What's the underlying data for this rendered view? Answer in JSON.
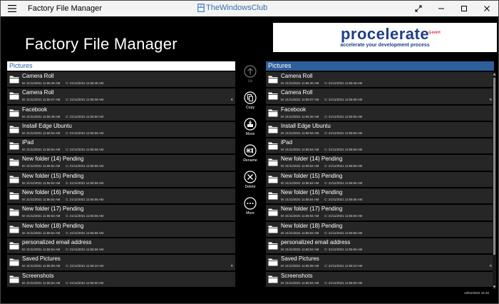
{
  "window": {
    "title": "Factory File Manager",
    "watermark": "TheWindowsClub"
  },
  "header": {
    "big_title": "Factory File Manager",
    "banner": {
      "brand": "procelerate",
      "gmbh": "GmbH",
      "tagline": "accelerate your development process"
    }
  },
  "colors": {
    "accent": "#2d5f9a",
    "row_bg": "#262626",
    "background": "#000000"
  },
  "left_pane": {
    "header": "Pictures",
    "items": [
      {
        "name": "Camera Roll",
        "modified": "M: 21/11/2021 11:55:46 AM",
        "created": "C: 21/11/2021 11:55:48 AM",
        "flag": ""
      },
      {
        "name": "Camera Roll",
        "modified": "M: 21/11/2021 11:55:07 AM",
        "created": "C: 21/11/2021 11:55:08 AM",
        "flag": "R"
      },
      {
        "name": "Facebook",
        "modified": "M: 21/11/2021 11:55:48 AM",
        "created": "C: 21/11/2021 11:55:50 AM",
        "flag": ""
      },
      {
        "name": "Install Edge Ubuntu",
        "modified": "M: 21/11/2021 11:55:54 AM",
        "created": "C: 21/11/2021 11:55:56 AM",
        "flag": ""
      },
      {
        "name": "iPad",
        "modified": "M: 21/11/2021 11:55:54 AM",
        "created": "C: 21/11/2021 11:55:56 AM",
        "flag": ""
      },
      {
        "name": "New folder (14) Pending",
        "modified": "M: 21/11/2021 11:55:54 AM",
        "created": "C: 21/11/2021 11:55:56 AM",
        "flag": ""
      },
      {
        "name": "New folder (15) Pending",
        "modified": "M: 21/11/2021 11:55:54 AM",
        "created": "C: 21/11/2021 11:55:56 AM",
        "flag": ""
      },
      {
        "name": "New folder (16) Pending",
        "modified": "M: 21/11/2021 11:55:54 AM",
        "created": "C: 21/11/2021 11:55:56 AM",
        "flag": ""
      },
      {
        "name": "New folder (17) Pending",
        "modified": "M: 21/11/2021 11:55:54 AM",
        "created": "C: 21/11/2021 11:55:56 AM",
        "flag": ""
      },
      {
        "name": "New folder (18) Pending",
        "modified": "M: 21/11/2021 11:55:54 AM",
        "created": "C: 21/11/2021 11:55:56 AM",
        "flag": ""
      },
      {
        "name": "personalized email address",
        "modified": "M: 21/11/2021 11:55:54 AM",
        "created": "C: 21/11/2021 11:55:56 AM",
        "flag": ""
      },
      {
        "name": "Saved Pictures",
        "modified": "M: 21/11/2021 11:55:08 AM",
        "created": "C: 21/11/2021 11:55:10 AM",
        "flag": "R"
      },
      {
        "name": "Screenshots",
        "modified": "M: 21/11/2021 11:55:54 AM",
        "created": "C: 21/11/2021 11:55:50 AM",
        "flag": ""
      }
    ]
  },
  "right_pane": {
    "header": "Pictures",
    "items": [
      {
        "name": "Camera Roll",
        "modified": "M: 21/11/2021 11:55:46 AM",
        "created": "C: 21/11/2021 11:55:48 AM",
        "flag": ""
      },
      {
        "name": "Camera Roll",
        "modified": "M: 21/11/2021 11:55:07 AM",
        "created": "C: 21/11/2021 11:55:08 AM",
        "flag": "R"
      },
      {
        "name": "Facebook",
        "modified": "M: 21/11/2021 11:55:48 AM",
        "created": "C: 21/11/2021 11:55:50 AM",
        "flag": ""
      },
      {
        "name": "Install Edge Ubuntu",
        "modified": "M: 21/11/2021 11:55:54 AM",
        "created": "C: 21/11/2021 11:55:56 AM",
        "flag": ""
      },
      {
        "name": "iPad",
        "modified": "M: 21/11/2021 11:55:54 AM",
        "created": "C: 21/11/2021 11:55:56 AM",
        "flag": ""
      },
      {
        "name": "New folder (14) Pending",
        "modified": "M: 21/11/2021 11:55:54 AM",
        "created": "C: 21/11/2021 11:55:56 AM",
        "flag": ""
      },
      {
        "name": "New folder (15) Pending",
        "modified": "M: 21/11/2021 11:55:54 AM",
        "created": "C: 21/11/2021 11:55:56 AM",
        "flag": ""
      },
      {
        "name": "New folder (16) Pending",
        "modified": "M: 21/11/2021 11:55:54 AM",
        "created": "C: 21/11/2021 11:55:56 AM",
        "flag": ""
      },
      {
        "name": "New folder (17) Pending",
        "modified": "M: 21/11/2021 11:55:54 AM",
        "created": "C: 21/11/2021 11:55:56 AM",
        "flag": ""
      },
      {
        "name": "New folder (18) Pending",
        "modified": "M: 21/11/2021 11:55:54 AM",
        "created": "C: 21/11/2021 11:55:56 AM",
        "flag": ""
      },
      {
        "name": "personalized email address",
        "modified": "M: 21/11/2021 11:55:54 AM",
        "created": "C: 21/11/2021 11:55:56 AM",
        "flag": ""
      },
      {
        "name": "Saved Pictures",
        "modified": "M: 21/11/2021 11:55:08 AM",
        "created": "C: 21/11/2021 11:55:10 AM",
        "flag": "R"
      },
      {
        "name": "Screenshots",
        "modified": "M: 21/11/2021 11:55:54 AM",
        "created": "C: 21/11/2021 11:55:50 AM",
        "flag": ""
      }
    ]
  },
  "actions": [
    {
      "label": "Up",
      "icon": "arrow-up-icon",
      "enabled": false
    },
    {
      "label": "Copy",
      "icon": "copy-icon",
      "enabled": true
    },
    {
      "label": "Move",
      "icon": "move-icon",
      "enabled": true
    },
    {
      "label": "Rename",
      "icon": "rename-icon",
      "enabled": true
    },
    {
      "label": "Delete",
      "icon": "delete-icon",
      "enabled": true
    },
    {
      "label": "More",
      "icon": "more-icon",
      "enabled": true
    }
  ],
  "status": {
    "clock": "13/01/2022 15:32"
  }
}
